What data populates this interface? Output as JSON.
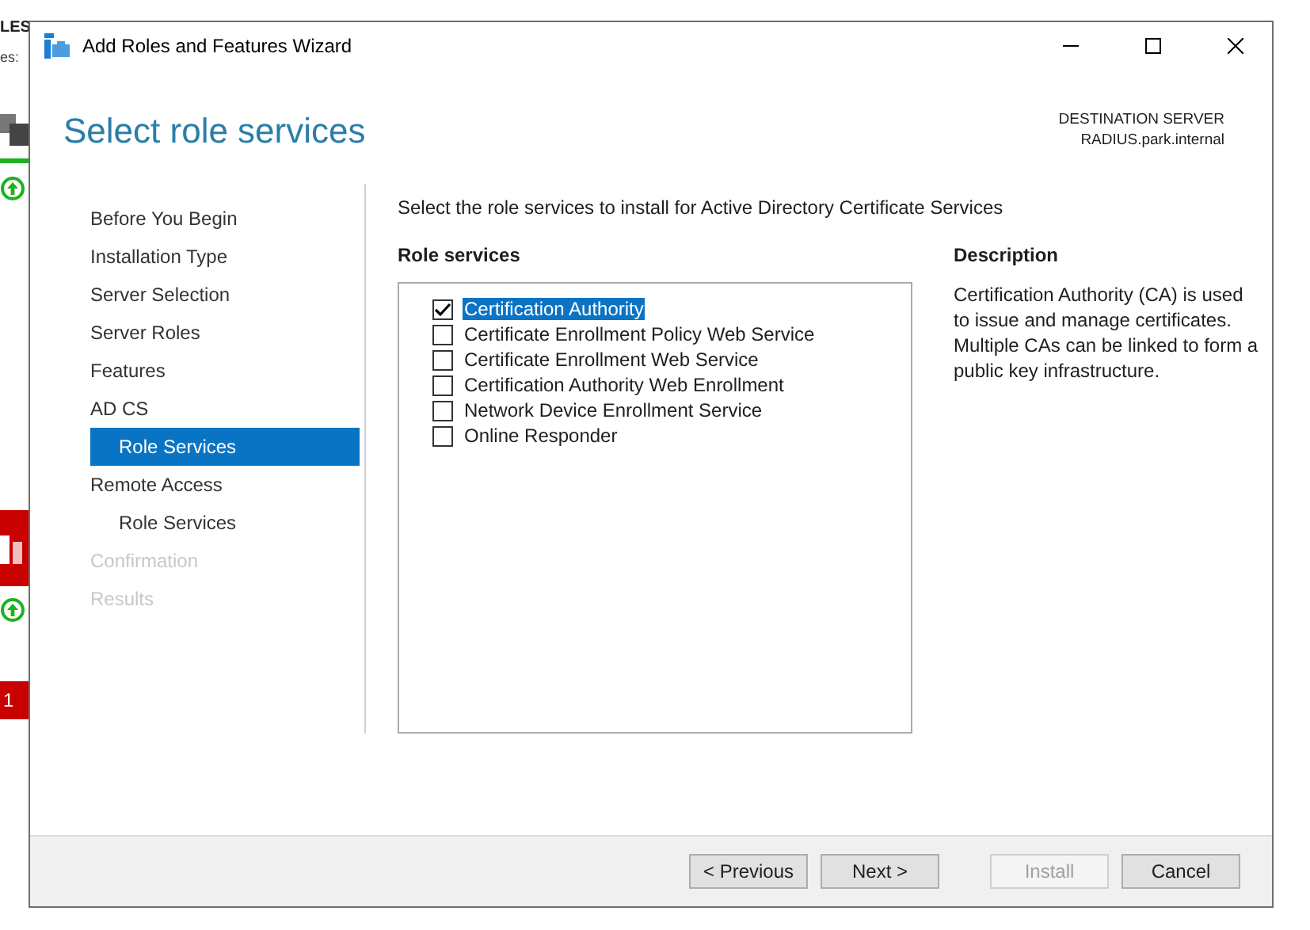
{
  "background_app": {
    "title_fragment": "LES",
    "subtitle_fragment": "es:",
    "badge": "1"
  },
  "window": {
    "title": "Add Roles and Features Wizard"
  },
  "header": {
    "title": "Select role services",
    "destination_label": "DESTINATION SERVER",
    "destination_server": "RADIUS.park.internal"
  },
  "steps": [
    {
      "label": "Before You Begin",
      "selected": false,
      "disabled": false
    },
    {
      "label": "Installation Type",
      "selected": false,
      "disabled": false
    },
    {
      "label": "Server Selection",
      "selected": false,
      "disabled": false
    },
    {
      "label": "Server Roles",
      "selected": false,
      "disabled": false
    },
    {
      "label": "Features",
      "selected": false,
      "disabled": false
    },
    {
      "label": "AD CS",
      "selected": false,
      "disabled": false,
      "children": [
        {
          "label": "Role Services",
          "selected": true,
          "disabled": false
        }
      ]
    },
    {
      "label": "Remote Access",
      "selected": false,
      "disabled": false,
      "children": [
        {
          "label": "Role Services",
          "selected": false,
          "disabled": false
        }
      ]
    },
    {
      "label": "Confirmation",
      "selected": false,
      "disabled": true
    },
    {
      "label": "Results",
      "selected": false,
      "disabled": true
    }
  ],
  "instruction": "Select the role services to install for Active Directory Certificate Services",
  "role_services": {
    "heading": "Role services",
    "items": [
      {
        "label": "Certification Authority",
        "checked": true,
        "selected": true
      },
      {
        "label": "Certificate Enrollment Policy Web Service",
        "checked": false,
        "selected": false
      },
      {
        "label": "Certificate Enrollment Web Service",
        "checked": false,
        "selected": false
      },
      {
        "label": "Certification Authority Web Enrollment",
        "checked": false,
        "selected": false
      },
      {
        "label": "Network Device Enrollment Service",
        "checked": false,
        "selected": false
      },
      {
        "label": "Online Responder",
        "checked": false,
        "selected": false
      }
    ]
  },
  "description": {
    "heading": "Description",
    "text": "Certification Authority (CA) is used to issue and manage certificates. Multiple CAs can be linked to form a public key infrastructure."
  },
  "buttons": [
    {
      "label": "< Previous",
      "disabled": false
    },
    {
      "label": "Next >",
      "disabled": false
    },
    {
      "label": "Install",
      "disabled": true
    },
    {
      "label": "Cancel",
      "disabled": false
    }
  ]
}
